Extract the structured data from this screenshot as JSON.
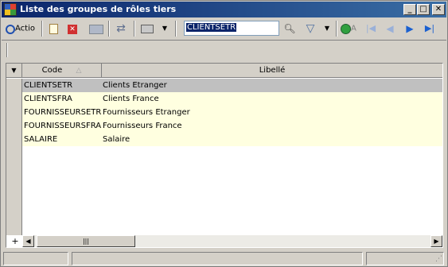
{
  "window": {
    "title": "Liste des groupes de rôles tiers",
    "buttons": {
      "minimize": "_",
      "maximize": "□",
      "close": "✕"
    }
  },
  "toolbar": {
    "action_label": "Actio",
    "search_value": "CLIENTSETR",
    "a_label": "A"
  },
  "grid": {
    "columns": [
      "Code",
      "Libellé"
    ],
    "rows": [
      {
        "code": "CLIENTSETR",
        "label": "Clients Etranger",
        "selected": true
      },
      {
        "code": "CLIENTSFRA",
        "label": "Clients France",
        "selected": false
      },
      {
        "code": "FOURNISSEURSETR",
        "label": "Fournisseurs Etranger",
        "selected": false
      },
      {
        "code": "FOURNISSEURSFRA",
        "label": "Fournisseurs France",
        "selected": false
      },
      {
        "code": "SALAIRE",
        "label": "Salaire",
        "selected": false
      }
    ],
    "add_symbol": "+"
  },
  "colors": {
    "row_selected": "#c0c0c0",
    "row_normal": "#ffffe0",
    "titlebar": "#0a246a"
  }
}
